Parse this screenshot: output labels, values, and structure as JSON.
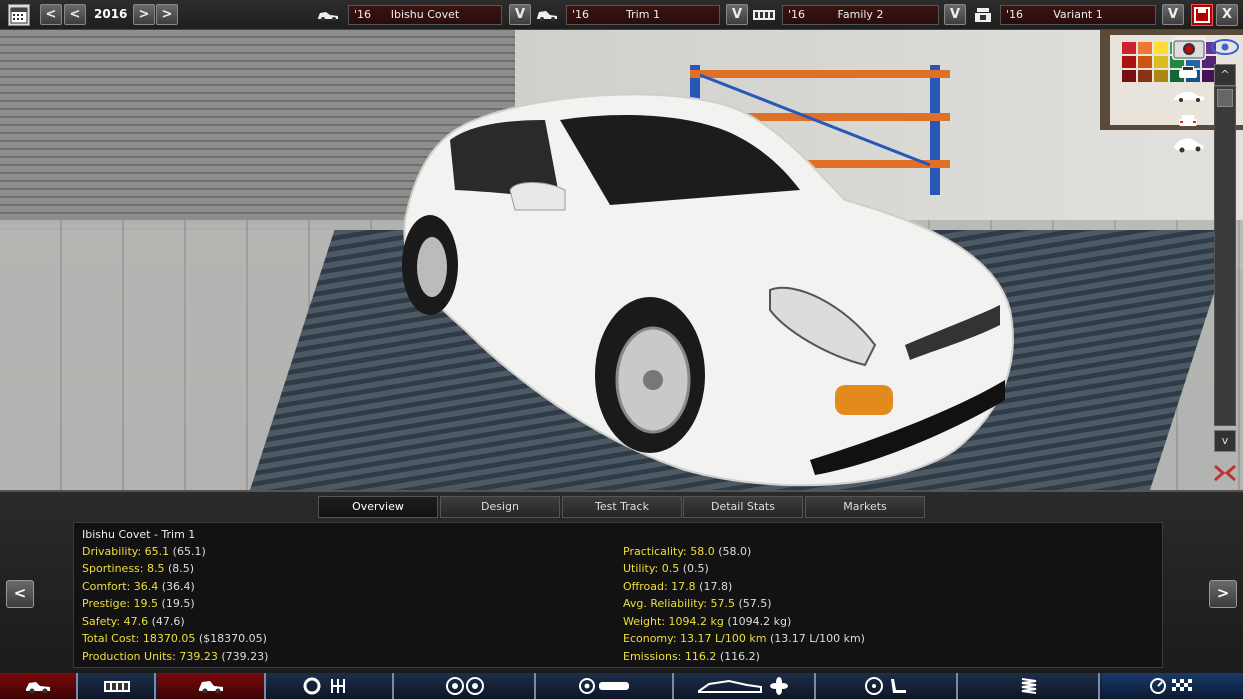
{
  "topbar": {
    "year": "2016",
    "model_selector": {
      "year": "'16",
      "name": "Ibishu Covet"
    },
    "trim_selector": {
      "year": "'16",
      "name": "Trim 1"
    },
    "family_selector": {
      "year": "'16",
      "name": "Family 2"
    },
    "variant_selector": {
      "year": "'16",
      "name": "Variant 1"
    },
    "prev_label": "<",
    "next_label": ">",
    "dropdown_label": "V",
    "close_label": "X"
  },
  "viewstrip": {
    "up_label": "^",
    "down_label": "v"
  },
  "tabs": [
    {
      "label": "Overview",
      "active": true
    },
    {
      "label": "Design",
      "active": false
    },
    {
      "label": "Test Track",
      "active": false
    },
    {
      "label": "Detail Stats",
      "active": false
    },
    {
      "label": "Markets",
      "active": false
    }
  ],
  "stats": {
    "title": "Ibishu Covet - Trim 1",
    "left": [
      {
        "label": "Drivability: 65.1",
        "paren": "(65.1)"
      },
      {
        "label": "Sportiness: 8.5",
        "paren": "(8.5)"
      },
      {
        "label": "Comfort: 36.4",
        "paren": "(36.4)"
      },
      {
        "label": "Prestige: 19.5",
        "paren": "(19.5)"
      },
      {
        "label": "Safety: 47.6",
        "paren": "(47.6)"
      },
      {
        "label": "Total Cost: 18370.05",
        "paren": "($18370.05)"
      },
      {
        "label": "Production Units: 739.23",
        "paren": "(739.23)"
      }
    ],
    "right": [
      {
        "label": "Practicality: 58.0",
        "paren": "(58.0)"
      },
      {
        "label": "Utility: 0.5",
        "paren": "(0.5)"
      },
      {
        "label": "Offroad: 17.8",
        "paren": "(17.8)"
      },
      {
        "label": "Avg. Reliability: 57.5",
        "paren": "(57.5)"
      },
      {
        "label": "Weight: 1094.2 kg",
        "paren": "(1094.2 kg)"
      },
      {
        "label": "Economy: 13.17 L/100 km",
        "paren": "(13.17 L/100 km)"
      },
      {
        "label": "Emissions: 116.2",
        "paren": "(116.2)"
      }
    ],
    "side_prev": "<",
    "side_next": ">"
  },
  "colors": {
    "stat_label": "#f0de3a",
    "accent_red": "#c00000",
    "nav_blue": "#1d2e4a"
  }
}
